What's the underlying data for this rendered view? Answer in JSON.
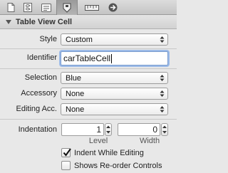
{
  "section": {
    "title": "Table View Cell"
  },
  "style": {
    "label": "Style",
    "value": "Custom"
  },
  "identifier": {
    "label": "Identifier",
    "value": "carTableCell"
  },
  "selection": {
    "label": "Selection",
    "value": "Blue"
  },
  "accessory": {
    "label": "Accessory",
    "value": "None"
  },
  "editing_acc": {
    "label": "Editing Acc.",
    "value": "None"
  },
  "indentation": {
    "label": "Indentation",
    "level_value": "1",
    "level_label": "Level",
    "width_value": "0",
    "width_label": "Width"
  },
  "indent_while_editing": {
    "label": "Indent While Editing",
    "checked": true
  },
  "shows_reorder": {
    "label": "Shows Re-order Controls",
    "checked": false
  },
  "icons": {
    "tabs": [
      "file-icon",
      "help-icon",
      "identity-icon",
      "attributes-icon",
      "size-icon",
      "connections-icon"
    ],
    "disclosure": "disclosure-triangle-icon",
    "popup_arrows": "popup-arrows-icon",
    "checkmark": "checkmark-icon"
  }
}
